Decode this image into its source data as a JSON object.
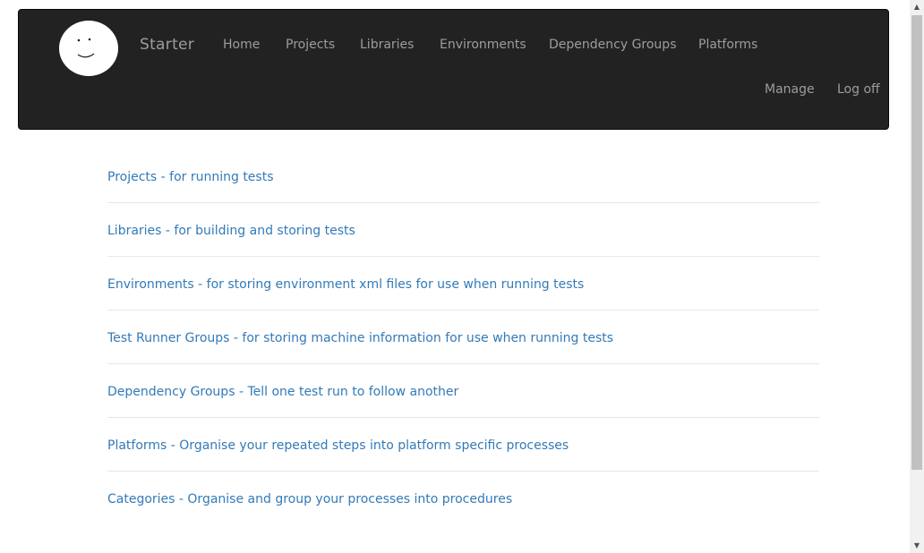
{
  "navbar": {
    "brand": "Starter",
    "items": [
      {
        "label": "Home"
      },
      {
        "label": "Projects"
      },
      {
        "label": "Libraries"
      },
      {
        "label": "Environments"
      },
      {
        "label": "Dependency Groups"
      },
      {
        "label": "Platforms"
      }
    ],
    "right_items": [
      {
        "label": "Manage"
      },
      {
        "label": "Log off"
      }
    ],
    "logo_icon": "smiley-face-icon",
    "background": "#222222",
    "text_color": "#9d9d9d"
  },
  "links": [
    {
      "label": "Projects - for running tests"
    },
    {
      "label": "Libraries - for building and storing tests"
    },
    {
      "label": "Environments - for storing environment xml files for use when running tests"
    },
    {
      "label": "Test Runner Groups - for storing machine information for use when running tests"
    },
    {
      "label": "Dependency Groups - Tell one test run to follow another"
    },
    {
      "label": "Platforms - Organise your repeated steps into platform specific processes"
    },
    {
      "label": "Categories - Organise and group your processes into procedures"
    }
  ],
  "link_color": "#337ab7",
  "scrollbar": {
    "up_icon": "scroll-up-arrow-icon",
    "down_icon": "scroll-down-arrow-icon"
  }
}
